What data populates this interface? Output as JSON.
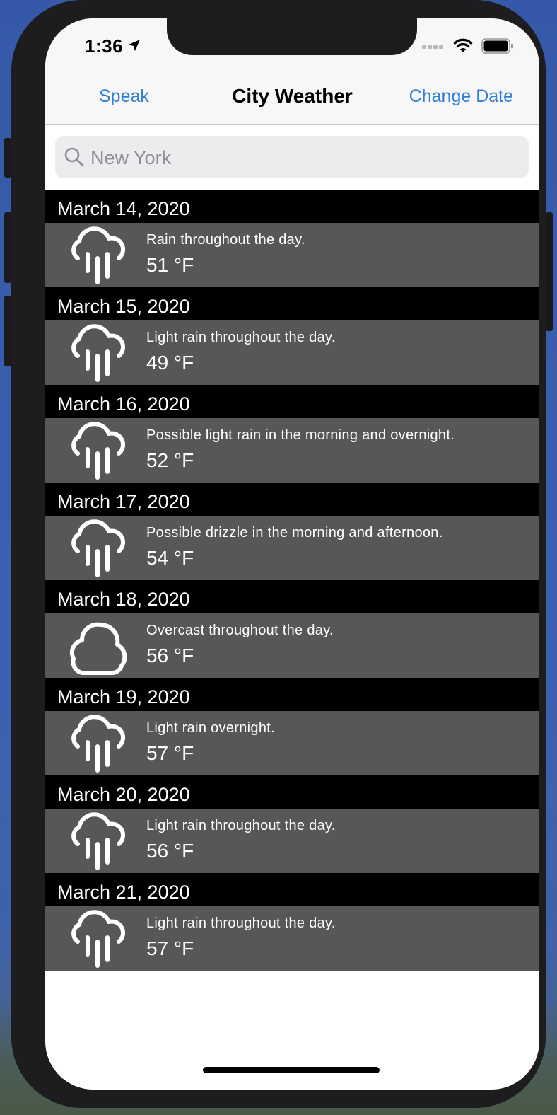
{
  "status_bar": {
    "time": "1:36"
  },
  "nav": {
    "left_button": "Speak",
    "title": "City Weather",
    "right_button": "Change Date"
  },
  "search": {
    "placeholder": "New York",
    "value": ""
  },
  "days": [
    {
      "date": "March 14, 2020",
      "summary": "Rain throughout the day.",
      "temp": "51 °F",
      "icon": "rain-icon"
    },
    {
      "date": "March 15, 2020",
      "summary": "Light rain throughout the day.",
      "temp": "49 °F",
      "icon": "rain-icon"
    },
    {
      "date": "March 16, 2020",
      "summary": "Possible light rain in the morning and overnight.",
      "temp": "52 °F",
      "icon": "rain-icon"
    },
    {
      "date": "March 17, 2020",
      "summary": "Possible drizzle in the morning and afternoon.",
      "temp": "54 °F",
      "icon": "rain-icon"
    },
    {
      "date": "March 18, 2020",
      "summary": "Overcast throughout the day.",
      "temp": "56 °F",
      "icon": "cloud-icon"
    },
    {
      "date": "March 19, 2020",
      "summary": "Light rain overnight.",
      "temp": "57 °F",
      "icon": "rain-icon"
    },
    {
      "date": "March 20, 2020",
      "summary": "Light rain throughout the day.",
      "temp": "56 °F",
      "icon": "rain-icon"
    },
    {
      "date": "March 21, 2020",
      "summary": "Light rain throughout the day.",
      "temp": "57 °F",
      "icon": "rain-icon"
    }
  ],
  "colors": {
    "accent": "#2f7fd6",
    "section_header_bg": "#000000",
    "row_bg": "#575757"
  }
}
